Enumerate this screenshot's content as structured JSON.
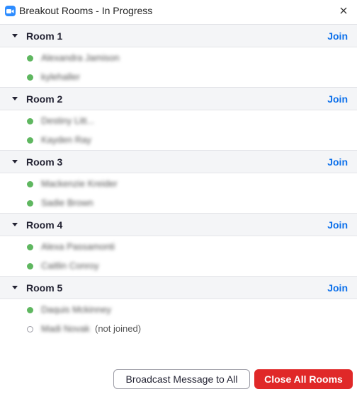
{
  "window": {
    "title": "Breakout Rooms - In Progress",
    "brand_color": "#2D8CFF",
    "icons": {
      "app": "zoom-logo-icon",
      "close": "close-icon",
      "caret": "caret-down-icon"
    }
  },
  "rooms": [
    {
      "name": "Room 1",
      "join_label": "Join",
      "participants": [
        {
          "name": "Alexandra Jamison",
          "joined": true,
          "status": ""
        },
        {
          "name": "kylehaller",
          "joined": true,
          "status": ""
        }
      ]
    },
    {
      "name": "Room 2",
      "join_label": "Join",
      "participants": [
        {
          "name": "Destiny Litt...",
          "joined": true,
          "status": ""
        },
        {
          "name": "Kayden Ray",
          "joined": true,
          "status": ""
        }
      ]
    },
    {
      "name": "Room 3",
      "join_label": "Join",
      "participants": [
        {
          "name": "Mackenzie Kreider",
          "joined": true,
          "status": ""
        },
        {
          "name": "Sadie Brown",
          "joined": true,
          "status": ""
        }
      ]
    },
    {
      "name": "Room 4",
      "join_label": "Join",
      "participants": [
        {
          "name": "Alexa Passamonti",
          "joined": true,
          "status": ""
        },
        {
          "name": "Caitlin Conroy",
          "joined": true,
          "status": ""
        }
      ]
    },
    {
      "name": "Room 5",
      "join_label": "Join",
      "participants": [
        {
          "name": "Daquis Mckinney",
          "joined": true,
          "status": ""
        },
        {
          "name": "Madi Novak",
          "joined": false,
          "status": "(not joined)"
        }
      ]
    }
  ],
  "footer": {
    "broadcast_label": "Broadcast Message to All",
    "close_all_label": "Close All Rooms",
    "close_all_color": "#e02828"
  },
  "colors": {
    "join_link": "#0e71eb",
    "joined_dot": "#5fb760",
    "header_bg": "#f4f5f7"
  }
}
